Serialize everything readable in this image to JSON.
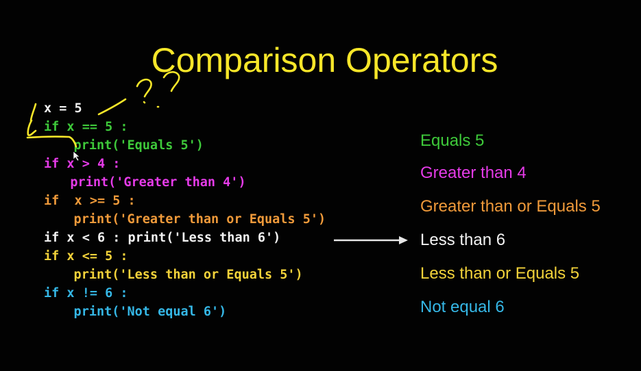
{
  "title": "Comparison Operators",
  "colors": {
    "background": "#020202",
    "title": "#f7e629",
    "white": "#f2f2f2",
    "green": "#3ec93a",
    "magenta": "#e53be8",
    "orange": "#f09a3a",
    "yellow": "#f2d23a",
    "cyan": "#35b7e6",
    "annotation_yellow": "#f7e629"
  },
  "code_lines": [
    "x = 5",
    "if x == 5 :",
    "    print('Equals 5')",
    "if x > 4 :",
    "   print('Greater than 4')",
    "if  x >= 5 :",
    "    print('Greater than or Equals 5')",
    "if x < 6 : print('Less than 6')",
    "if x <= 5 :",
    "    print('Less than or Equals 5')",
    "if x != 6 :",
    "    print('Not equal 6')"
  ],
  "outputs": [
    "Equals 5",
    "Greater than 4",
    "Greater than or Equals 5",
    "Less than 6",
    "Less than or Equals 5",
    "Not equal 6"
  ],
  "annotation": {
    "question_marks": "??",
    "arrow": "arrow-right-icon"
  }
}
